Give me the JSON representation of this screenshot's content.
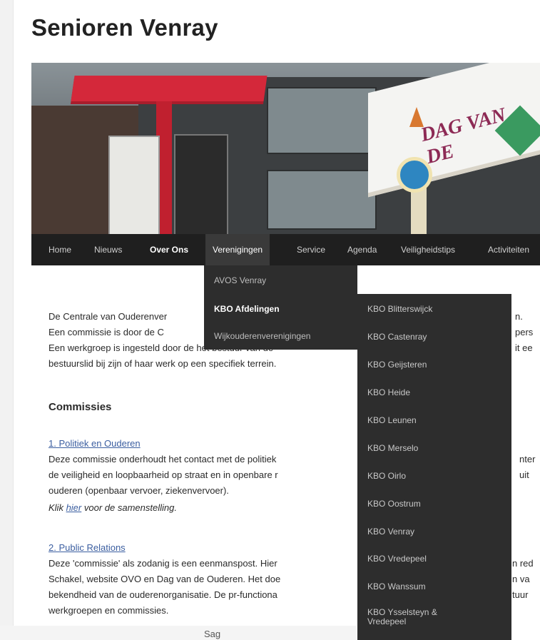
{
  "site": {
    "title": "Senioren Venray"
  },
  "banner": {
    "sign_text": "DAG VAN DE"
  },
  "nav": {
    "items": [
      {
        "label": "Home"
      },
      {
        "label": "Nieuws"
      },
      {
        "label": "Over Ons"
      },
      {
        "label": "Verenigingen"
      },
      {
        "label": "Service"
      },
      {
        "label": "Agenda"
      },
      {
        "label": "Veiligheidstips"
      },
      {
        "label": "Activiteiten"
      }
    ]
  },
  "dropdown_verenigingen": {
    "items": [
      {
        "label": "AVOS Venray"
      },
      {
        "label": "KBO Afdelingen"
      },
      {
        "label": "Wijkouderenverenigingen"
      }
    ]
  },
  "dropdown_kbo": {
    "items": [
      {
        "label": "KBO Blitterswijck"
      },
      {
        "label": "KBO Castenray"
      },
      {
        "label": "KBO Geijsteren"
      },
      {
        "label": "KBO Heide"
      },
      {
        "label": "KBO Leunen"
      },
      {
        "label": "KBO Merselo"
      },
      {
        "label": "KBO Oirlo"
      },
      {
        "label": "KBO Oostrum"
      },
      {
        "label": "KBO Venray"
      },
      {
        "label": "KBO Vredepeel"
      },
      {
        "label": "KBO Wanssum"
      },
      {
        "label": "KBO Ysselsteyn & Vredepeel"
      }
    ]
  },
  "content": {
    "intro": [
      "De Centrale van Ouderenver",
      "Een commissie is door de C",
      "Een werkgroep is ingesteld door de het bestuur van de",
      "bestuurslid bij zijn of haar werk op een specifiek terrein."
    ],
    "intro_right": [
      "n.",
      "pers",
      "it ee"
    ],
    "commissies_heading": "Commissies",
    "item1": {
      "title": "1. Politiek en Ouderen",
      "lines": [
        "Deze commissie onderhoudt het contact met de politiek",
        "de veiligheid en loopbaarheid op straat en in openbare r",
        "ouderen (openbaar vervoer, ziekenvervoer)."
      ],
      "lines_right": [
        "nter",
        "uit"
      ],
      "click_prefix": "Klik ",
      "click_link": "hier",
      "click_suffix": " voor de samenstelling."
    },
    "item2": {
      "title": "2. Public Relations",
      "lines": [
        "Deze 'commissie' als zodanig is een eenmanspost. Hier",
        "Schakel, website OVO en Dag van de Ouderen. Het doe",
        "bekendheid van de ouderenorganisatie. De pr-functiona",
        "werkgroepen en commissies."
      ],
      "lines_right": [
        "n red",
        "n va",
        "tuur"
      ]
    },
    "footer_fragment": "Sag"
  }
}
